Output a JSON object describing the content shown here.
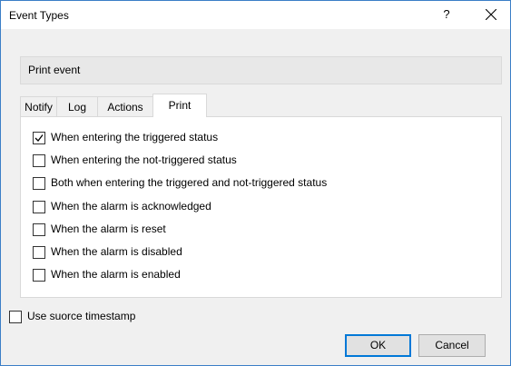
{
  "dialog": {
    "title": "Event Types",
    "help_label": "?",
    "close_icon": "close-icon"
  },
  "header": {
    "label": "Print event"
  },
  "tabs": [
    {
      "label": "Notify",
      "active": false
    },
    {
      "label": "Log",
      "active": false
    },
    {
      "label": "Actions",
      "active": false
    },
    {
      "label": "Print",
      "active": true
    }
  ],
  "print_options": [
    {
      "label": "When entering the triggered status",
      "checked": true
    },
    {
      "label": "When entering the not-triggered status",
      "checked": false
    },
    {
      "label": "Both when entering the triggered and not-triggered status",
      "checked": false
    },
    {
      "label": "When the alarm is acknowledged",
      "checked": false
    },
    {
      "label": "When the alarm is reset",
      "checked": false
    },
    {
      "label": "When the alarm is disabled",
      "checked": false
    },
    {
      "label": "When the alarm is enabled",
      "checked": false
    }
  ],
  "use_source_timestamp": {
    "label": "Use suorce timestamp",
    "checked": false
  },
  "buttons": {
    "ok": "OK",
    "cancel": "Cancel"
  },
  "colors": {
    "accent": "#0078d7",
    "window_border": "#3b7ec7",
    "background": "#f0f0f0"
  }
}
